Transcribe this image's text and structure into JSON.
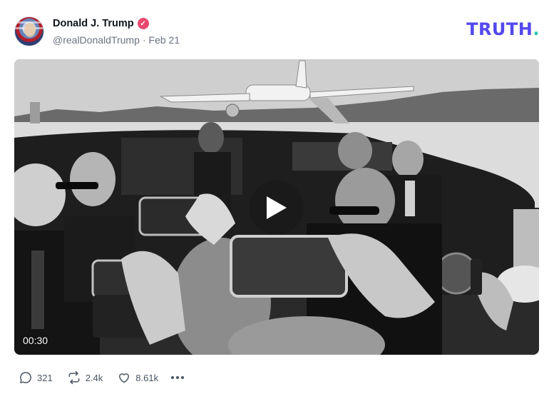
{
  "post": {
    "author_name": "Donald J. Trump",
    "author_handle": "@realDonaldTrump",
    "separator": "·",
    "date": "Feb 21",
    "verified_icon": "check-badge-icon",
    "verified_color": "#e8486f"
  },
  "brand": {
    "logo_text": "TRUTH",
    "logo_dot": ".",
    "logo_color": "#5448ee",
    "dot_color": "#23c6b8"
  },
  "video": {
    "duration": "00:30",
    "play_icon": "play-icon"
  },
  "actions": {
    "replies": "321",
    "retruths": "2.4k",
    "likes": "8.61k",
    "reply_icon": "reply-bubble-icon",
    "retruth_icon": "retruth-arrows-icon",
    "like_icon": "heart-icon",
    "more_icon": "more-dots-icon"
  }
}
